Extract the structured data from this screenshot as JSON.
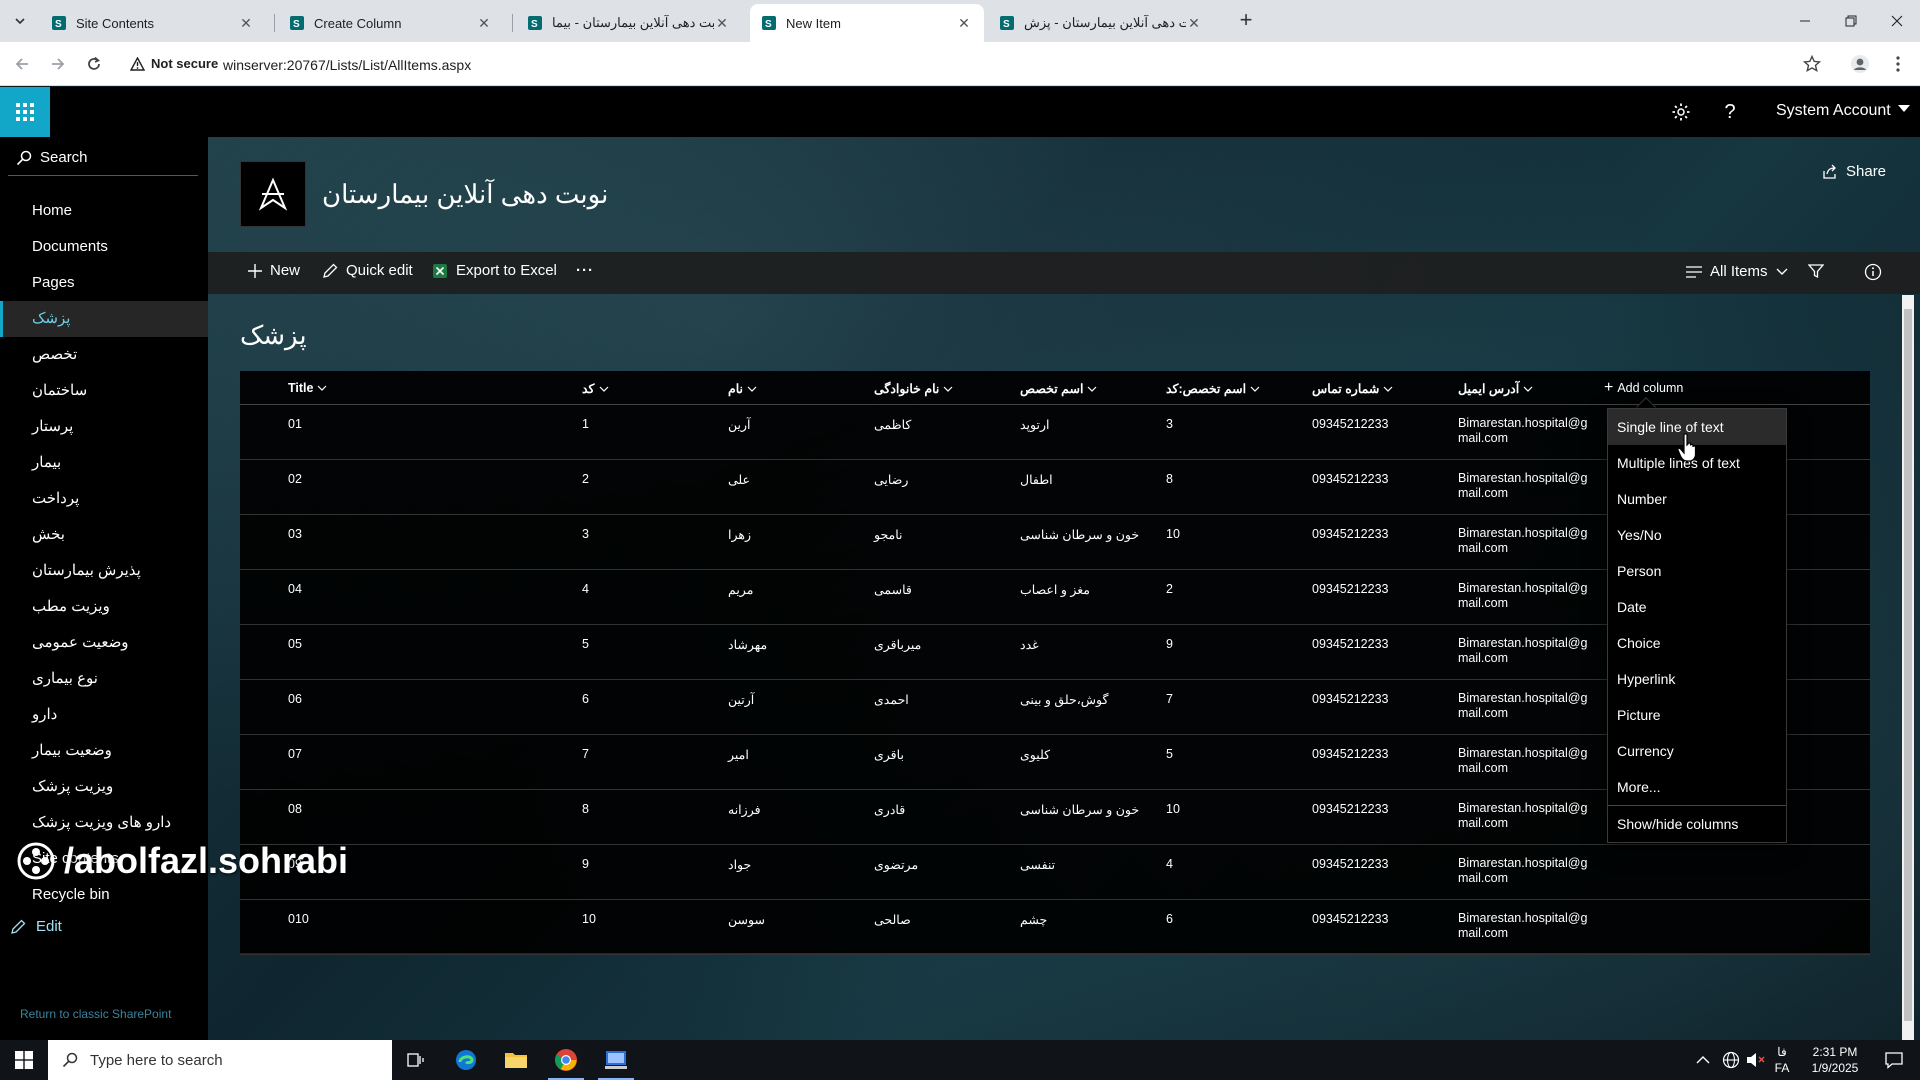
{
  "browser": {
    "tabs": [
      {
        "title": "Site Contents",
        "active": false
      },
      {
        "title": "Create Column",
        "active": false
      },
      {
        "title": "نوبت دهی آنلاین بیمارستان - بیما",
        "active": false
      },
      {
        "title": "New Item",
        "active": true
      },
      {
        "title": "نوبت دهی آنلاین بیمارستان - پزش",
        "active": false
      }
    ],
    "security_label": "Not secure",
    "url": "winserver:20767/Lists/List/AllItems.aspx"
  },
  "suitebar": {
    "account": "System Account"
  },
  "leftnav": {
    "search_label": "Search",
    "items": [
      {
        "label": "Home",
        "selected": false
      },
      {
        "label": "Documents",
        "selected": false
      },
      {
        "label": "Pages",
        "selected": false
      },
      {
        "label": "پزشک",
        "selected": true
      },
      {
        "label": "تخصص",
        "selected": false
      },
      {
        "label": "ساختمان",
        "selected": false
      },
      {
        "label": "پرستار",
        "selected": false
      },
      {
        "label": "بیمار",
        "selected": false
      },
      {
        "label": "پرداخت",
        "selected": false
      },
      {
        "label": "بخش",
        "selected": false
      },
      {
        "label": "پذیرش بیمارستان",
        "selected": false
      },
      {
        "label": "ویزیت مطب",
        "selected": false
      },
      {
        "label": "وضعیت عمومی",
        "selected": false
      },
      {
        "label": "نوع بیماری",
        "selected": false
      },
      {
        "label": "دارو",
        "selected": false
      },
      {
        "label": "وضعیت بیمار",
        "selected": false
      },
      {
        "label": "ویزیت پزشک",
        "selected": false
      },
      {
        "label": "دارو های ویزیت پزشک",
        "selected": false
      },
      {
        "label": "Site contents",
        "selected": false
      },
      {
        "label": "Recycle bin",
        "selected": false
      }
    ],
    "edit_label": "Edit",
    "classic_link": "Return to classic SharePoint",
    "watermark": "/abolfazl.sohrabi"
  },
  "site": {
    "title": "نوبت دهی آنلاین بیمارستان",
    "share_label": "Share"
  },
  "commandbar": {
    "new_label": "New",
    "quick_edit_label": "Quick edit",
    "export_label": "Export to Excel",
    "more_label": "···",
    "view_label": "All Items"
  },
  "list": {
    "title": "پزشک",
    "columns": [
      "Title",
      "کد",
      "نام",
      "نام خانوادگی",
      "اسم تخصص",
      "اسم تخصص:کد",
      "شماره تماس",
      "آدرس ایمیل"
    ],
    "add_column_label": "Add column",
    "rows": [
      {
        "title": "01",
        "code": "1",
        "name": "آرین",
        "family": "کاظمی",
        "specialty": "ارتوپد",
        "spec_code": "3",
        "phone": "09345212233",
        "email1": "Bimarestan.hospital@g",
        "email2": "mail.com"
      },
      {
        "title": "02",
        "code": "2",
        "name": "علی",
        "family": "رضایی",
        "specialty": "اطفال",
        "spec_code": "8",
        "phone": "09345212233",
        "email1": "Bimarestan.hospital@g",
        "email2": "mail.com"
      },
      {
        "title": "03",
        "code": "3",
        "name": "زهرا",
        "family": "نامجو",
        "specialty": "خون و سرطان شناسی",
        "spec_code": "10",
        "phone": "09345212233",
        "email1": "Bimarestan.hospital@g",
        "email2": "mail.com"
      },
      {
        "title": "04",
        "code": "4",
        "name": "مریم",
        "family": "قاسمی",
        "specialty": "مغز و اعصاب",
        "spec_code": "2",
        "phone": "09345212233",
        "email1": "Bimarestan.hospital@g",
        "email2": "mail.com"
      },
      {
        "title": "05",
        "code": "5",
        "name": "مهرشاد",
        "family": "میرباقری",
        "specialty": "غدد",
        "spec_code": "9",
        "phone": "09345212233",
        "email1": "Bimarestan.hospital@g",
        "email2": "mail.com"
      },
      {
        "title": "06",
        "code": "6",
        "name": "آرتین",
        "family": "احمدی",
        "specialty": "گوش،حلق و بینی",
        "spec_code": "7",
        "phone": "09345212233",
        "email1": "Bimarestan.hospital@g",
        "email2": "mail.com"
      },
      {
        "title": "07",
        "code": "7",
        "name": "امیر",
        "family": "باقری",
        "specialty": "کلیوی",
        "spec_code": "5",
        "phone": "09345212233",
        "email1": "Bimarestan.hospital@g",
        "email2": "mail.com"
      },
      {
        "title": "08",
        "code": "8",
        "name": "فرزانه",
        "family": "قادری",
        "specialty": "خون و سرطان شناسی",
        "spec_code": "10",
        "phone": "09345212233",
        "email1": "Bimarestan.hospital@g",
        "email2": "mail.com"
      },
      {
        "title": "09",
        "code": "9",
        "name": "جواد",
        "family": "مرتضوی",
        "specialty": "تنفسی",
        "spec_code": "4",
        "phone": "09345212233",
        "email1": "Bimarestan.hospital@g",
        "email2": "mail.com"
      },
      {
        "title": "010",
        "code": "10",
        "name": "سوسن",
        "family": "صالحی",
        "specialty": "چشم",
        "spec_code": "6",
        "phone": "09345212233",
        "email1": "Bimarestan.hospital@g",
        "email2": "mail.com"
      }
    ]
  },
  "add_column_menu": {
    "items": [
      "Single line of text",
      "Multiple lines of text",
      "Number",
      "Yes/No",
      "Person",
      "Date",
      "Choice",
      "Hyperlink",
      "Picture",
      "Currency",
      "More..."
    ],
    "hovered_index": 0,
    "footer": "Show/hide columns"
  },
  "taskbar": {
    "search_placeholder": "Type here to search",
    "language": "FA",
    "language_short": "فا",
    "time": "2:31 PM",
    "date": "1/9/2025"
  },
  "colors": {
    "accent": "#12a7c9",
    "chrome_bg": "#dee1e6",
    "suite_bg": "#000000"
  }
}
